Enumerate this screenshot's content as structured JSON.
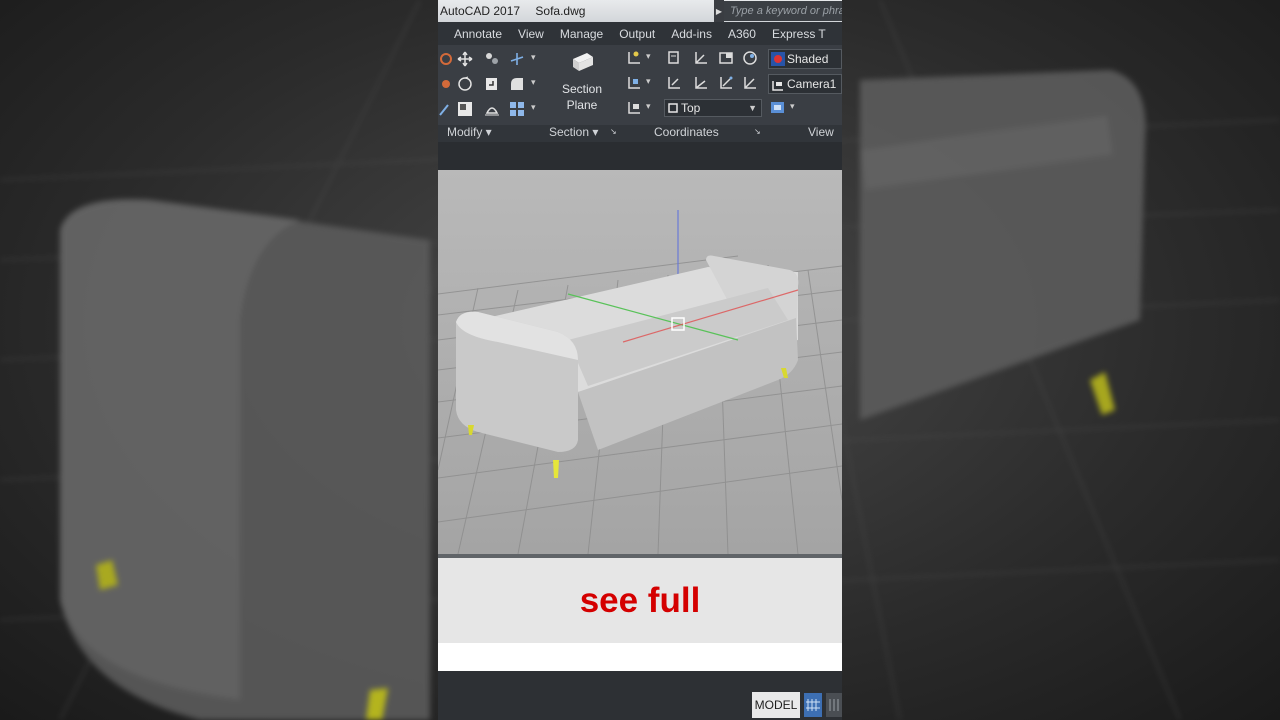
{
  "app": {
    "name": "AutoCAD 2017",
    "file": "Sofa.dwg"
  },
  "search": {
    "placeholder": "Type a keyword or phra"
  },
  "tabs": [
    "Annotate",
    "View",
    "Manage",
    "Output",
    "Add-ins",
    "A360",
    "Express T"
  ],
  "ribbon": {
    "section_plane_line1": "Section",
    "section_plane_line2": "Plane",
    "ucs_view_combo": "Top",
    "visual_style": "Shaded",
    "camera": "Camera1"
  },
  "panels": {
    "modify": "Modify",
    "section": "Section",
    "coordinates": "Coordinates",
    "view": "View"
  },
  "caption": "see full",
  "status": {
    "model": "MODEL"
  },
  "colors": {
    "accent": "#d40000",
    "legs": "#e6e63a",
    "axis_x": "#e05050",
    "axis_y": "#59c259",
    "axis_z": "#6a7ad6"
  }
}
